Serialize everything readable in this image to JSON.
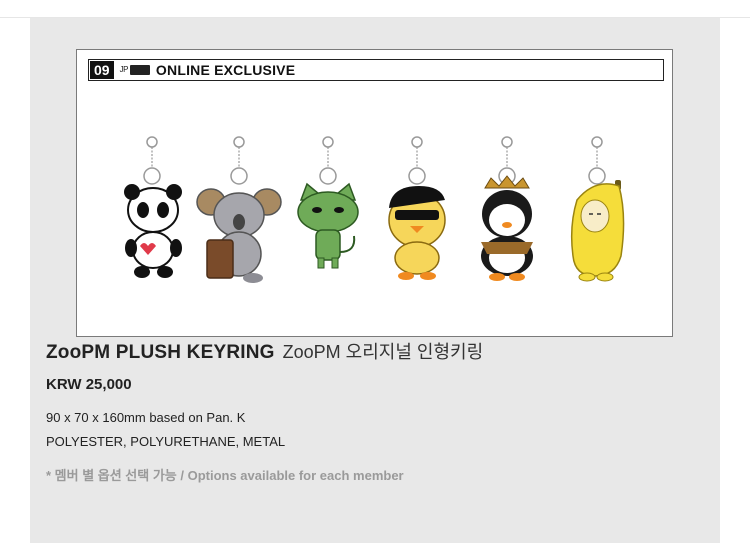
{
  "item": {
    "number": "09",
    "brand_mark": "JP",
    "badge": "ONLINE EXCLUSIVE",
    "title_en": "ZooPM PLUSH KEYRING",
    "title_ko": "ZooPM 오리지널 인형키링",
    "price": "KRW 25,000",
    "size": "90 x 70 x 160mm based on Pan. K",
    "material": "POLYESTER, POLYURETHANE, METAL",
    "note": "* 멤버 별 옵션 선택 가능 / Options available for each member"
  },
  "keyrings": [
    {
      "name": "panda-keyring-icon"
    },
    {
      "name": "koala-keyring-icon"
    },
    {
      "name": "cat-keyring-icon"
    },
    {
      "name": "chick-keyring-icon"
    },
    {
      "name": "penguin-keyring-icon"
    },
    {
      "name": "banana-keyring-icon"
    }
  ],
  "colors": {
    "panel": "#e8e8e8",
    "badge_bg": "#111111",
    "note": "#9a9a9a"
  }
}
